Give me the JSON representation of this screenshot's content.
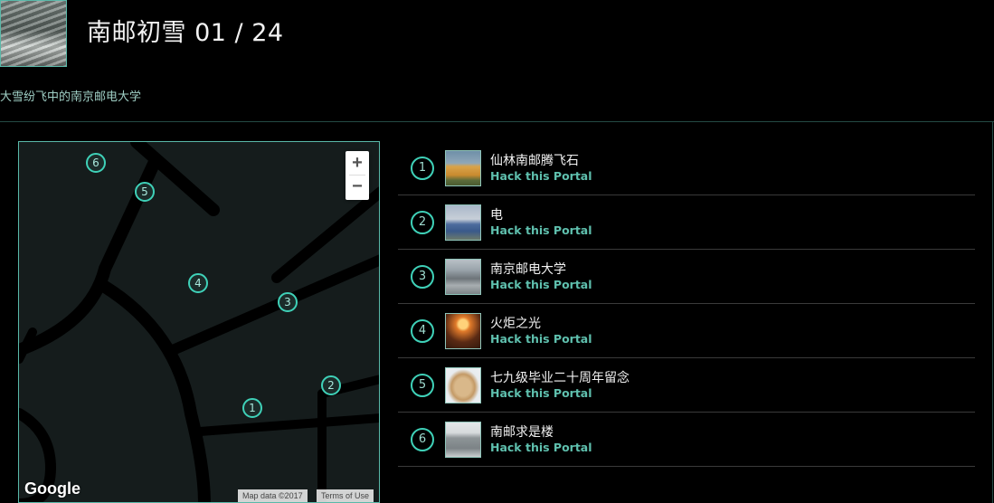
{
  "header": {
    "title": "南邮初雪 01 / 24",
    "subtitle": "大雪纷飞中的南京邮电大学"
  },
  "map": {
    "zoom_in": "+",
    "zoom_out": "−",
    "logo": "Google",
    "attribution": "Map data ©2017",
    "terms": "Terms of Use",
    "markers": [
      "1",
      "2",
      "3",
      "4",
      "5",
      "6"
    ]
  },
  "portals": [
    {
      "num": "1",
      "name": "仙林南邮腾飞石",
      "action": "Hack this Portal"
    },
    {
      "num": "2",
      "name": "电",
      "action": "Hack this Portal"
    },
    {
      "num": "3",
      "name": "南京邮电大学",
      "action": "Hack this Portal"
    },
    {
      "num": "4",
      "name": "火炬之光",
      "action": "Hack this Portal"
    },
    {
      "num": "5",
      "name": "七九级毕业二十周年留念",
      "action": "Hack this Portal"
    },
    {
      "num": "6",
      "name": "南邮求是楼",
      "action": "Hack this Portal"
    }
  ],
  "colors": {
    "accent": "#3fd1b8",
    "link": "#5fc0ae",
    "background": "#000000",
    "map_background": "#151c1c"
  }
}
